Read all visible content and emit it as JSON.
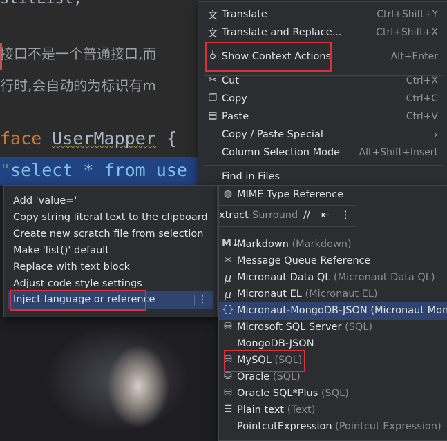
{
  "editor": {
    "top_line": "stitList;",
    "comment_line_1": "接口不是一个普通接口,而",
    "comment_line_2": "行时,会自动的为标识有m",
    "interface_keyword": "face",
    "interface_name": "UserMapper",
    "interface_brace": "{",
    "select_quote": "\"",
    "select_text": "select * from use"
  },
  "context_menu": {
    "items": [
      {
        "label": "Translate",
        "shortcut": "Ctrl+Shift+Y",
        "icon": "translate-icon"
      },
      {
        "label": "Translate and Replace...",
        "shortcut": "Ctrl+Shift+X",
        "icon": "translate-replace-icon"
      },
      {
        "label": "Show Context Actions",
        "shortcut": "Alt+Enter",
        "icon": "lightbulb-icon"
      },
      {
        "label": "Cut",
        "shortcut": "Ctrl+X",
        "icon": "cut-icon"
      },
      {
        "label": "Copy",
        "shortcut": "Ctrl+C",
        "icon": "copy-icon"
      },
      {
        "label": "Paste",
        "shortcut": "Ctrl+V",
        "icon": "paste-icon"
      },
      {
        "label": "Copy / Paste Special",
        "shortcut": "›",
        "icon": ""
      },
      {
        "label": "Column Selection Mode",
        "shortcut": "Alt+Shift+Insert",
        "icon": ""
      },
      {
        "label": "Find in Files",
        "shortcut": "",
        "icon": ""
      }
    ]
  },
  "intentions": {
    "items": [
      "Add 'value='",
      "Copy string literal text to the clipboard",
      "Create new scratch file from selection",
      "Make 'list()' default",
      "Replace with text block",
      "Adjust code style settings",
      "Inject language or reference"
    ],
    "more_glyph": "⋮"
  },
  "toolbar": {
    "extract": "xtract",
    "surround": "Surround",
    "comment": "//",
    "format": "⇤",
    "more": "⋮"
  },
  "languages": {
    "items": [
      {
        "name": "MIME Type Reference",
        "sub": "",
        "icon": "globe-icon"
      },
      {
        "name": "Markdown",
        "sub": "(Markdown)",
        "icon": "markdown-icon"
      },
      {
        "name": "Message Queue Reference",
        "sub": "",
        "icon": "message-queue-icon"
      },
      {
        "name": "Micronaut Data QL",
        "sub": "(Micronaut Data QL)",
        "icon": "micronaut-icon"
      },
      {
        "name": "Micronaut EL",
        "sub": "(Micronaut EL)",
        "icon": "micronaut-icon"
      },
      {
        "name": "Micronaut-MongoDB-JSON",
        "sub": "(Micronaut Mong",
        "icon": "json-braces-icon"
      },
      {
        "name": "Microsoft SQL Server",
        "sub": "(SQL)",
        "icon": "database-icon"
      },
      {
        "name": "MongoDB-JSON",
        "sub": "",
        "icon": ""
      },
      {
        "name": "MySQL",
        "sub": "(SQL)",
        "icon": "database-icon"
      },
      {
        "name": "Oracle",
        "sub": "(SQL)",
        "icon": "database-icon"
      },
      {
        "name": "Oracle SQL*Plus",
        "sub": "(SQL)",
        "icon": "database-icon"
      },
      {
        "name": "Plain text",
        "sub": "(Text)",
        "icon": "text-lines-icon"
      },
      {
        "name": "PointcutExpression",
        "sub": "(Pointcut Expression)",
        "icon": ""
      }
    ]
  },
  "colors": {
    "highlight_box": "#d9303b",
    "selection": "#2e436e",
    "keyword": "#cc7832",
    "string": "#6a8759"
  }
}
